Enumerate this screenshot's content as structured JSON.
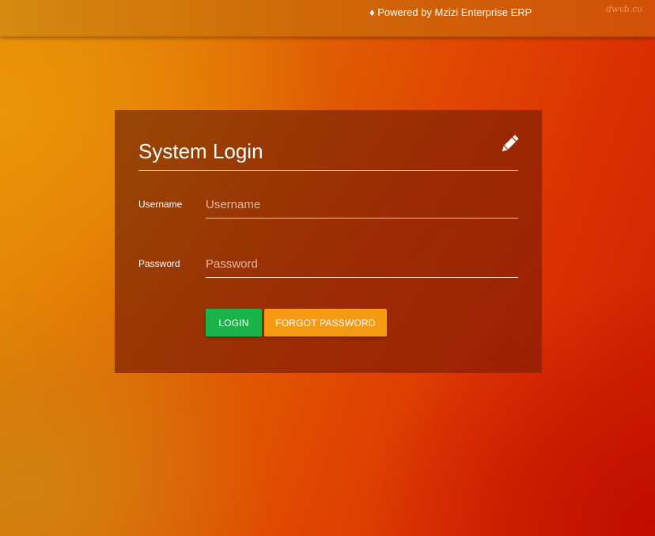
{
  "header": {
    "powered_by": "♦ Powered by Mzizi Enterprise ERP",
    "watermark": "dwvb.co"
  },
  "login": {
    "title": "System Login",
    "icon": "pencil-icon",
    "username": {
      "label": "Username",
      "placeholder": "Username",
      "value": ""
    },
    "password": {
      "label": "Password",
      "placeholder": "Password",
      "value": ""
    },
    "login_button": "LOGIN",
    "forgot_button": "FORGOT PASSWORD"
  },
  "colors": {
    "login_button": "#1ab34a",
    "forgot_button": "#f59a12",
    "background_left": "#e08a05",
    "background_right": "#cf1c02"
  }
}
